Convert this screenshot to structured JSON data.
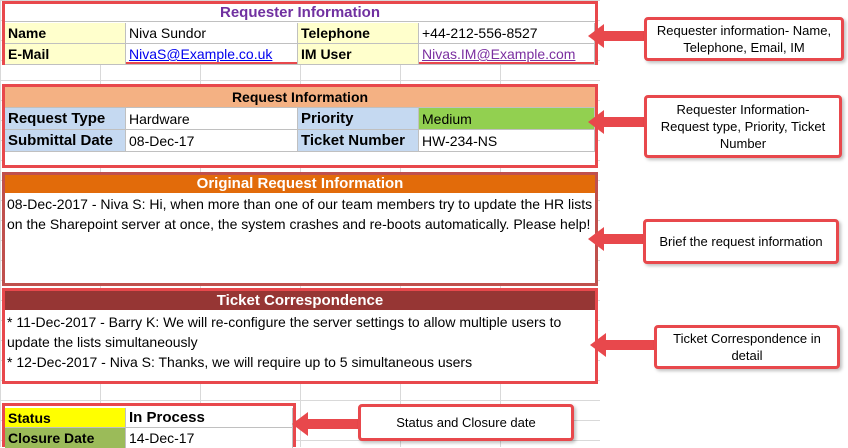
{
  "requester": {
    "title": "Requester Information",
    "name_label": "Name",
    "name_value": "Niva Sundor",
    "telephone_label": "Telephone",
    "telephone_value": "+44-212-556-8527",
    "email_label": "E-Mail",
    "email_value": "NivaS@Example.co.uk",
    "im_label": "IM User",
    "im_value": "Nivas.IM@Example.com"
  },
  "request": {
    "title": "Request Information",
    "type_label": "Request Type",
    "type_value": "Hardware",
    "priority_label": "Priority",
    "priority_value": "Medium",
    "date_label": "Submittal Date",
    "date_value": "08-Dec-17",
    "ticket_label": "Ticket Number",
    "ticket_value": "HW-234-NS"
  },
  "original": {
    "title": "Original Request Information",
    "text": "08-Dec-2017 - Niva S: Hi, when more than one of our team members try to update the HR lists on the Sharepoint server at once, the system crashes and re-boots automatically. Please help!"
  },
  "correspondence": {
    "title": "Ticket Correspondence",
    "line1": "* 11-Dec-2017 - Barry K: We will re-configure the server settings to allow multiple users to update the lists simultaneously",
    "line2": "* 12-Dec-2017 - Niva S: Thanks, we will require up to 5 simultaneous users"
  },
  "status": {
    "status_label": "Status",
    "status_value": "In Process",
    "closure_label": "Closure Date",
    "closure_value": "14-Dec-17"
  },
  "callouts": {
    "c1": "Requester information- Name, Telephone, Email, IM",
    "c2": "Requester Information- Request type, Priority, Ticket Number",
    "c3": "Brief the request information",
    "c4": "Ticket Correspondence in detail",
    "c5": "Status and Closure date"
  },
  "colors": {
    "accent_red": "#e8484c",
    "requester_header": "#7030a0",
    "label_yellow": "#ffffcc",
    "request_header": "#f4b183",
    "label_blue": "#c5d9f1",
    "priority_green": "#92d050",
    "original_header": "#e26b0a",
    "correspondence_header": "#963634",
    "status_yellow": "#ffff00",
    "closure_green": "#9bbb59"
  }
}
